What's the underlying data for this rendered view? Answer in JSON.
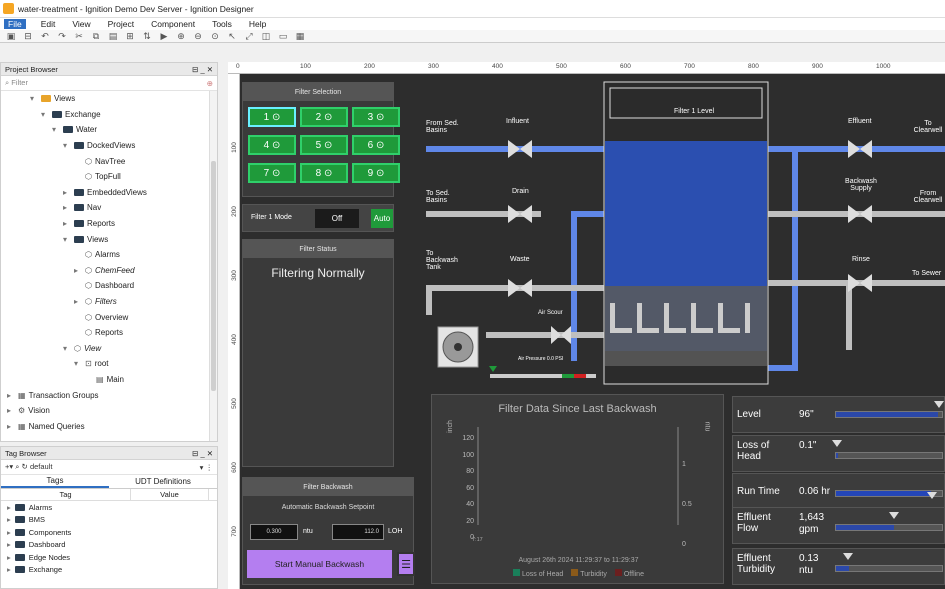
{
  "window": {
    "title": "water-treatment - Ignition Demo Dev Server - Ignition Designer"
  },
  "menu": [
    "File",
    "Edit",
    "View",
    "Project",
    "Component",
    "Tools",
    "Help"
  ],
  "project_browser": {
    "title": "Project Browser",
    "filter_placeholder": "Filter",
    "tree": [
      {
        "label": "Views",
        "depth": 1,
        "icon": "views-folder-icon"
      },
      {
        "label": "Exchange",
        "depth": 2,
        "icon": "folder-icon"
      },
      {
        "label": "Water",
        "depth": 3,
        "icon": "folder-icon"
      },
      {
        "label": "DockedViews",
        "depth": 4,
        "icon": "folder-icon"
      },
      {
        "label": "NavTree",
        "depth": 5,
        "icon": "view-icon"
      },
      {
        "label": "TopFull",
        "depth": 5,
        "icon": "view-icon"
      },
      {
        "label": "EmbeddedViews",
        "depth": 4,
        "icon": "folder-icon"
      },
      {
        "label": "Nav",
        "depth": 4,
        "icon": "folder-icon"
      },
      {
        "label": "Reports",
        "depth": 4,
        "icon": "folder-icon"
      },
      {
        "label": "Views",
        "depth": 4,
        "icon": "folder-icon"
      },
      {
        "label": "Alarms",
        "depth": 5,
        "icon": "view-icon"
      },
      {
        "label": "ChemFeed",
        "depth": 5,
        "icon": "view-icon",
        "italic": true
      },
      {
        "label": "Dashboard",
        "depth": 5,
        "icon": "view-icon"
      },
      {
        "label": "Filters",
        "depth": 5,
        "icon": "view-icon",
        "italic": true
      },
      {
        "label": "Overview",
        "depth": 5,
        "icon": "view-icon"
      },
      {
        "label": "Reports",
        "depth": 5,
        "icon": "view-icon"
      },
      {
        "label": "View",
        "depth": 4,
        "icon": "view-icon",
        "italic": true
      },
      {
        "label": "root",
        "depth": 5,
        "icon": "container-icon"
      },
      {
        "label": "Main",
        "depth": 6,
        "icon": "component-icon"
      },
      {
        "label": "Transaction Groups",
        "depth": 0,
        "icon": "transaction-icon"
      },
      {
        "label": "Vision",
        "depth": 0,
        "icon": "vision-icon"
      },
      {
        "label": "Named Queries",
        "depth": 0,
        "icon": "query-icon"
      }
    ]
  },
  "tag_browser": {
    "title": "Tag Browser",
    "provider": "default",
    "tabs": [
      "Tags",
      "UDT Definitions"
    ],
    "columns": [
      "Tag",
      "Value"
    ],
    "rows": [
      "Alarms",
      "BMS",
      "Components",
      "Dashboard",
      "Edge Nodes",
      "Exchange"
    ]
  },
  "ruler": {
    "h_ticks": [
      "0",
      "100",
      "200",
      "300",
      "400",
      "500",
      "600",
      "700",
      "800",
      "900",
      "1000"
    ],
    "v_ticks": [
      "100",
      "200",
      "300",
      "400",
      "500",
      "600",
      "700"
    ]
  },
  "filter_selection": {
    "title": "Filter Selection",
    "buttons": [
      "1",
      "2",
      "3",
      "4",
      "5",
      "6",
      "7",
      "8",
      "9"
    ],
    "mode_label": "Filter 1 Mode",
    "mode_off": "Off",
    "mode_auto": "Auto"
  },
  "filter_status": {
    "title": "Filter Status",
    "status": "Filtering Normally"
  },
  "filter_backwash": {
    "title": "Filter Backwash",
    "setpoint_label": "Automatic Backwash Setpoint",
    "ntu_value": "0.300",
    "ntu_unit": "ntu",
    "loh_value": "112.0",
    "loh_unit": "LOH",
    "button": "Start Manual Backwash"
  },
  "process": {
    "tank_title": "Filter 1 Level",
    "labels": {
      "from_sed": "From Sed. Basins",
      "influent": "Influent",
      "to_sed": "To Sed. Basins",
      "drain": "Drain",
      "to_backwash": "To Backwash Tank",
      "waste": "Waste",
      "air_scour": "Air Scour",
      "air_pressure": "Air Pressure 0.0 PSI",
      "effluent": "Effluent",
      "to_clearwell": "To Clearwell",
      "backwash_supply": "Backwash Supply",
      "from_clearwell": "From Clearwell",
      "rinse": "Rinse",
      "to_sewer": "To Sewer"
    }
  },
  "trend": {
    "title": "Filter Data Since Last Backwash",
    "left_unit": "inch",
    "right_unit": "ntu",
    "left_ticks": [
      "120",
      "100",
      "80",
      "60",
      "40",
      "20",
      "0"
    ],
    "right_ticks": [
      "1",
      "0.5",
      "0"
    ],
    "x_tick": "7:17",
    "range": "August 26th 2024 11:29:37 to 11:29:37",
    "legend": [
      {
        "name": "Loss of Head",
        "color": "#1a7f5a"
      },
      {
        "name": "Turbidity",
        "color": "#8a5a1a"
      },
      {
        "name": "Offline",
        "color": "#6b1f1f"
      }
    ]
  },
  "kpis": [
    {
      "label": "Level",
      "value": "96\"",
      "fill": 0.96
    },
    {
      "label": "Loss of Head",
      "value": "0.1\"",
      "fill": 0.02
    },
    {
      "label": "Run Time",
      "value": "0.06 hr",
      "fill": 0.9
    },
    {
      "label": "Effluent Flow",
      "value": "1,643 gpm",
      "fill": 0.55
    },
    {
      "label": "Effluent Turbidity",
      "value": "0.13 ntu",
      "fill": 0.12
    }
  ],
  "colors": {
    "accent": "#2f6fc2",
    "green": "#1f9a3a",
    "water": "#2b4fb0",
    "pipe": "#5f87e8"
  }
}
